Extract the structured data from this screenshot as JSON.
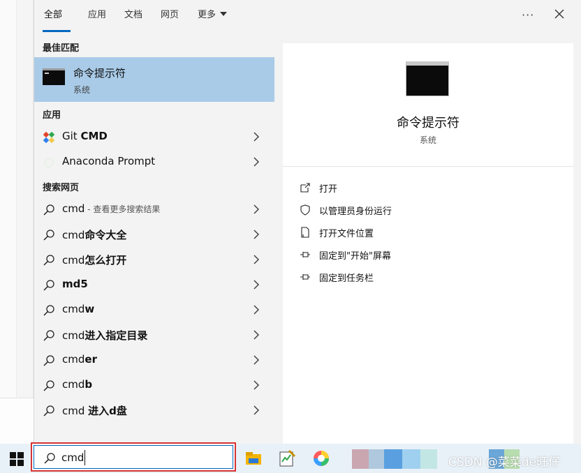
{
  "tabs": [
    {
      "label": "全部",
      "active": true
    },
    {
      "label": "应用"
    },
    {
      "label": "文档"
    },
    {
      "label": "网页"
    },
    {
      "label": "更多"
    }
  ],
  "window_controls": {
    "more": "···"
  },
  "best_match": {
    "section_title": "最佳匹配",
    "title": "命令提示符",
    "subtitle": "系统"
  },
  "apps": {
    "section_title": "应用",
    "items": [
      {
        "prefix": "Git ",
        "bold": "CMD",
        "icon": "git-icon"
      },
      {
        "prefix": "Anaconda Prompt",
        "bold": "",
        "icon": "anaconda-icon"
      }
    ]
  },
  "web": {
    "section_title": "搜索网页",
    "items": [
      {
        "prefix": "cmd",
        "bold": "",
        "suffix": " - 查看更多搜索结果"
      },
      {
        "prefix": "cmd",
        "bold": "命令大全",
        "suffix": ""
      },
      {
        "prefix": "cmd",
        "bold": "怎么打开",
        "suffix": ""
      },
      {
        "prefix": "",
        "bold": "md5",
        "suffix": ""
      },
      {
        "prefix": "cmd",
        "bold": "w",
        "suffix": ""
      },
      {
        "prefix": "cmd",
        "bold": "进入指定目录",
        "suffix": ""
      },
      {
        "prefix": "cmd",
        "bold": "er",
        "suffix": ""
      },
      {
        "prefix": "cmd",
        "bold": "b",
        "suffix": ""
      },
      {
        "prefix": "cmd ",
        "bold": "进入d盘",
        "suffix": ""
      }
    ]
  },
  "preview": {
    "title": "命令提示符",
    "subtitle": "系统",
    "actions": [
      {
        "label": "打开",
        "icon": "open-icon"
      },
      {
        "label": "以管理员身份运行",
        "icon": "shield-icon"
      },
      {
        "label": "打开文件位置",
        "icon": "file-location-icon"
      },
      {
        "label": "固定到\"开始\"屏幕",
        "icon": "pin-icon"
      },
      {
        "label": "固定到任务栏",
        "icon": "pin-icon"
      }
    ]
  },
  "search": {
    "value": "cmd"
  },
  "watermark": "CSDN @菜菜de旺仔",
  "colors": {
    "accent": "#0067c0",
    "selection": "#a9cbe8",
    "search_highlight": "#d63333"
  }
}
